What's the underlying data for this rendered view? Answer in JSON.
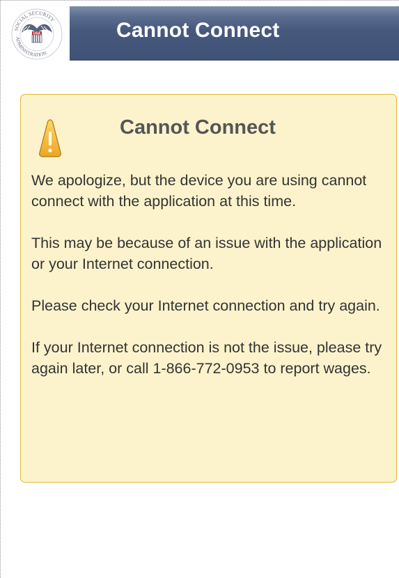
{
  "header": {
    "logo": {
      "icon": "ssa-seal-icon",
      "text_top": "SOCIAL SECURITY",
      "text_bottom": "ADMINISTRATION",
      "badge": "USA"
    },
    "title": "Cannot Connect"
  },
  "message": {
    "icon": "warning-icon",
    "title": "Cannot Connect",
    "paragraphs": [
      "We apologize, but the device you are using cannot connect with the application at this time.",
      "This may be because of an issue with the application or your Internet connection.",
      "Please check your Internet connection and try again.",
      "If your Internet connection is not the issue, please try again later, or call 1-866-772-0953 to report wages."
    ]
  },
  "colors": {
    "header_bar": "#44577b",
    "box_background": "#fcf3cc",
    "box_border": "#e3b833",
    "warning_fill": "#f2b431"
  }
}
